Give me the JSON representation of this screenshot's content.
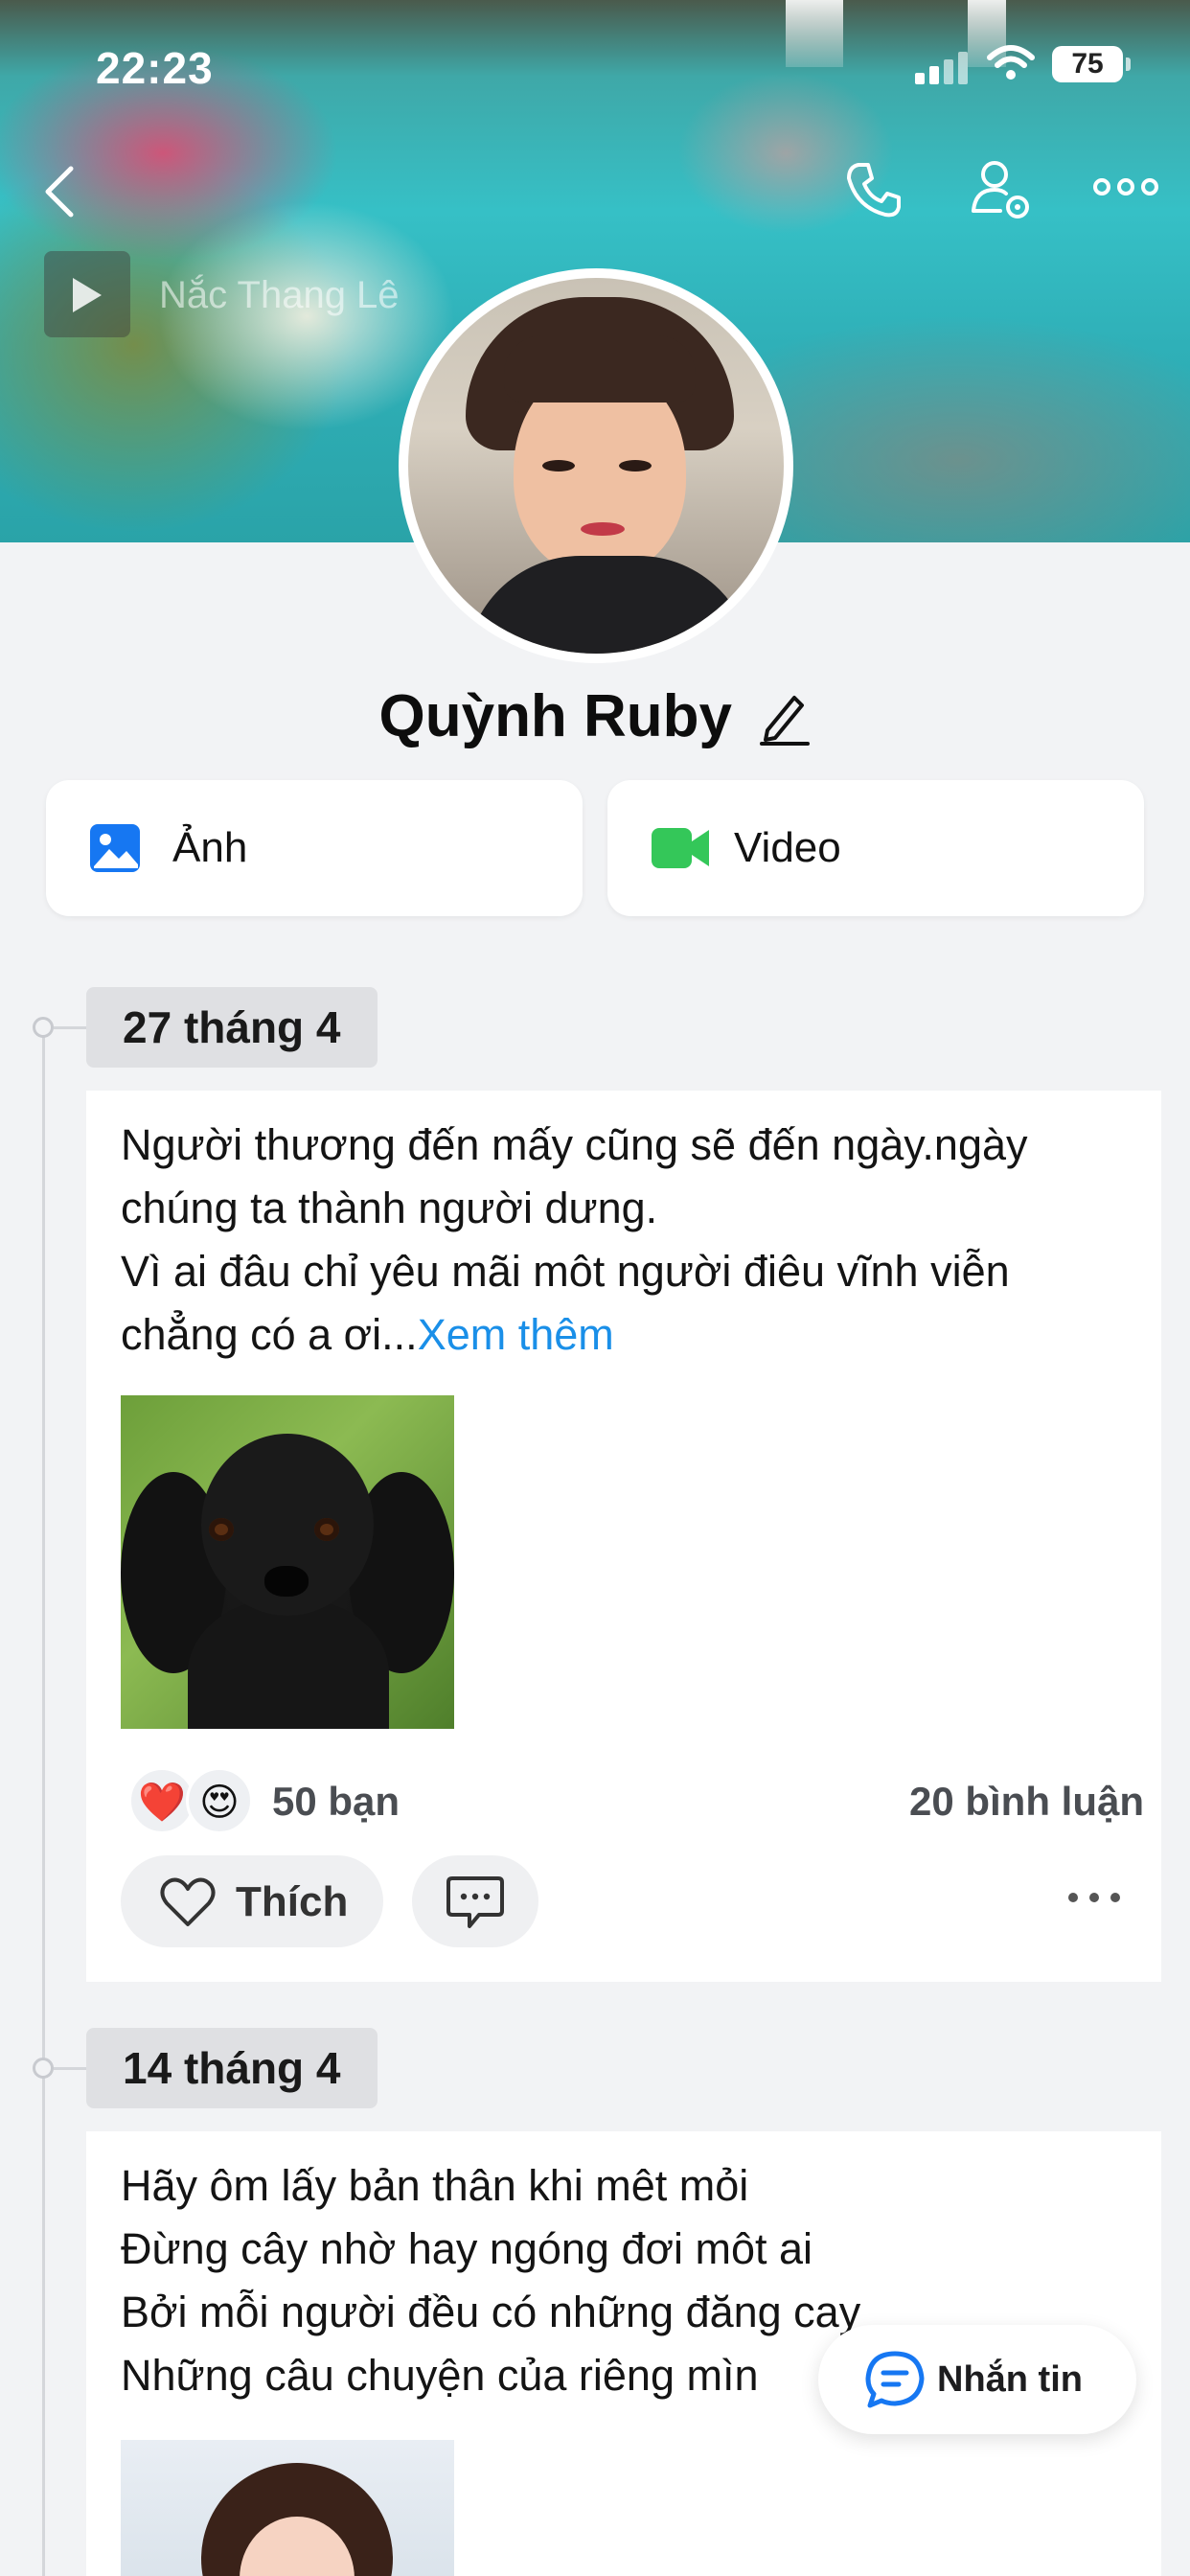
{
  "status_bar": {
    "time": "22:23",
    "battery": "75"
  },
  "cover": {
    "music_label": "Nắc Thang Lê"
  },
  "profile": {
    "name": "Quỳnh Ruby"
  },
  "media_buttons": {
    "photos_label": "Ảnh",
    "video_label": "Video"
  },
  "posts": [
    {
      "date": "27 tháng 4",
      "lines": [
        "Người thương đến mấy cũng sẽ đến ngày.ngày",
        "chúng ta thành người dưng.",
        "Vì ai đâu chỉ yêu mãi môt người điêu vĩnh viễn",
        "chẳng có a ơi..."
      ],
      "see_more": "Xem thêm",
      "reactions": {
        "emoji_1": "❤️",
        "emoji_2": "😍",
        "count": "50 bạn"
      },
      "comments": "20 bình luận",
      "like_label": "Thích"
    },
    {
      "date": "14 tháng 4",
      "lines": [
        "Hãy ôm lấy bản thân khi mêt mỏi",
        "Đừng cây nhờ hay ngóng đơi môt ai",
        "Bởi mỗi người đều có những đăng cay",
        "Những câu chuyện của riêng mìn"
      ]
    }
  ],
  "message_button": {
    "label": "Nhắn tin"
  },
  "colors": {
    "accent_blue": "#1a8fe8",
    "photo_icon_blue": "#1677f2",
    "video_icon_green": "#34c759"
  }
}
